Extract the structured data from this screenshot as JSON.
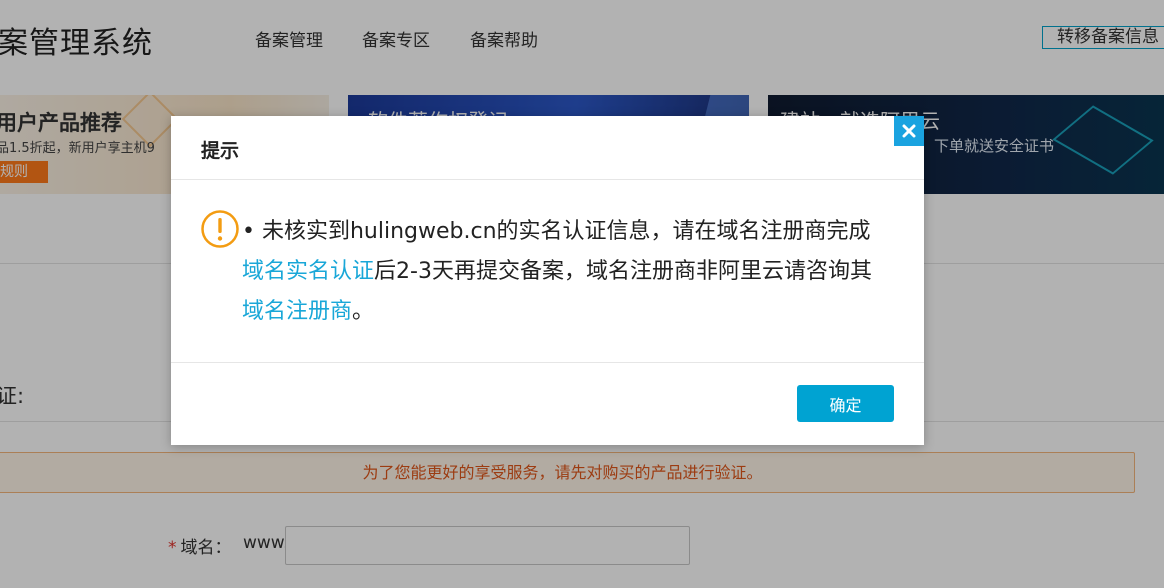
{
  "header": {
    "title": "案管理系统",
    "nav": [
      "备案管理",
      "备案专区",
      "备案帮助"
    ],
    "transfer_label": "转移备案信息"
  },
  "banners": {
    "b1": {
      "title": "用户产品推荐",
      "sub": "品1.5折起，新用户享主机9",
      "btn": "规则"
    },
    "b2": {
      "title": "软件著作权登记"
    },
    "b3": {
      "title": "建站，就选阿里云",
      "sub": "下单就送安全证书"
    }
  },
  "form": {
    "verify_label": "证:",
    "alert": "为了您能更好的享受服务，请先对购买的产品进行验证。",
    "domain_label": "域名：",
    "required_mark": "*",
    "prefix": "www.",
    "domain_value": ""
  },
  "modal": {
    "title": "提示",
    "bullet": "•",
    "text_1": "未核实到hulingweb.cn的实名认证信息，请在域名注册商完成",
    "link_1": "域名实名认证",
    "text_2": "后2-3天再提交备案，域名注册商非阿里云请咨询其",
    "link_2": "域名注册商",
    "text_3": "。",
    "ok_label": "确定"
  },
  "colors": {
    "accent": "#00a3d2",
    "link": "#19a7d8",
    "warning": "#f39c12",
    "alert_text": "#e0561a"
  }
}
